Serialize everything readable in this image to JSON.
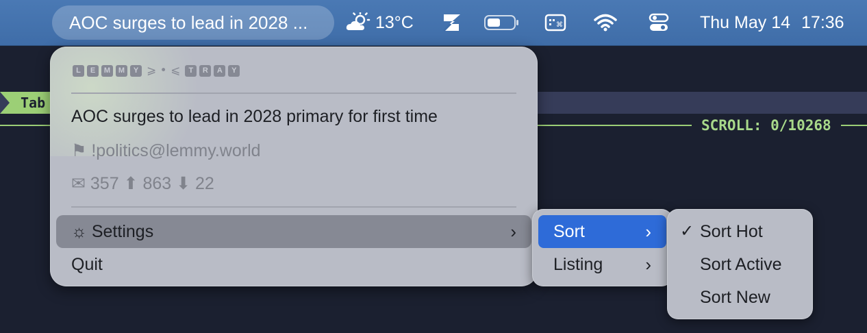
{
  "menubar": {
    "active_title": "AOC surges to lead in 2028 ...",
    "weather": {
      "icon": "sun-behind-cloud-icon",
      "temp": "13°C"
    },
    "app_icon": "z-app-icon",
    "battery_icon": "battery-icon",
    "keyboard_icon": "keyboard-viewer-icon",
    "wifi_icon": "wifi-icon",
    "control_center_icon": "control-center-icon",
    "date": "Thu May 14",
    "time": "17:36"
  },
  "terminal": {
    "tab_label": "Tab",
    "scroll_text": "SCROLL:  0/10268",
    "accent": "#9ccf76"
  },
  "menu": {
    "header_letters": [
      "L",
      "E",
      "M",
      "M",
      "Y"
    ],
    "header_symbols": "⩾ • ⩽",
    "header_letters2": [
      "T",
      "R",
      "A",
      "Y"
    ],
    "post": {
      "title": "AOC surges to lead in 2028 primary for first time",
      "community": "⚑ !politics@lemmy.world",
      "stats": "✉ 357 ⬆ 863 ⬇ 22"
    },
    "settings_label": "☼ Settings",
    "quit_label": "Quit"
  },
  "submenu_settings": {
    "sort_label": "Sort",
    "listing_label": "Listing",
    "highlight": "#2e6bd8"
  },
  "submenu_sort": {
    "items": [
      {
        "label": "Sort Hot",
        "checked": "✓"
      },
      {
        "label": "Sort Active",
        "checked": ""
      },
      {
        "label": "Sort New",
        "checked": ""
      }
    ]
  }
}
